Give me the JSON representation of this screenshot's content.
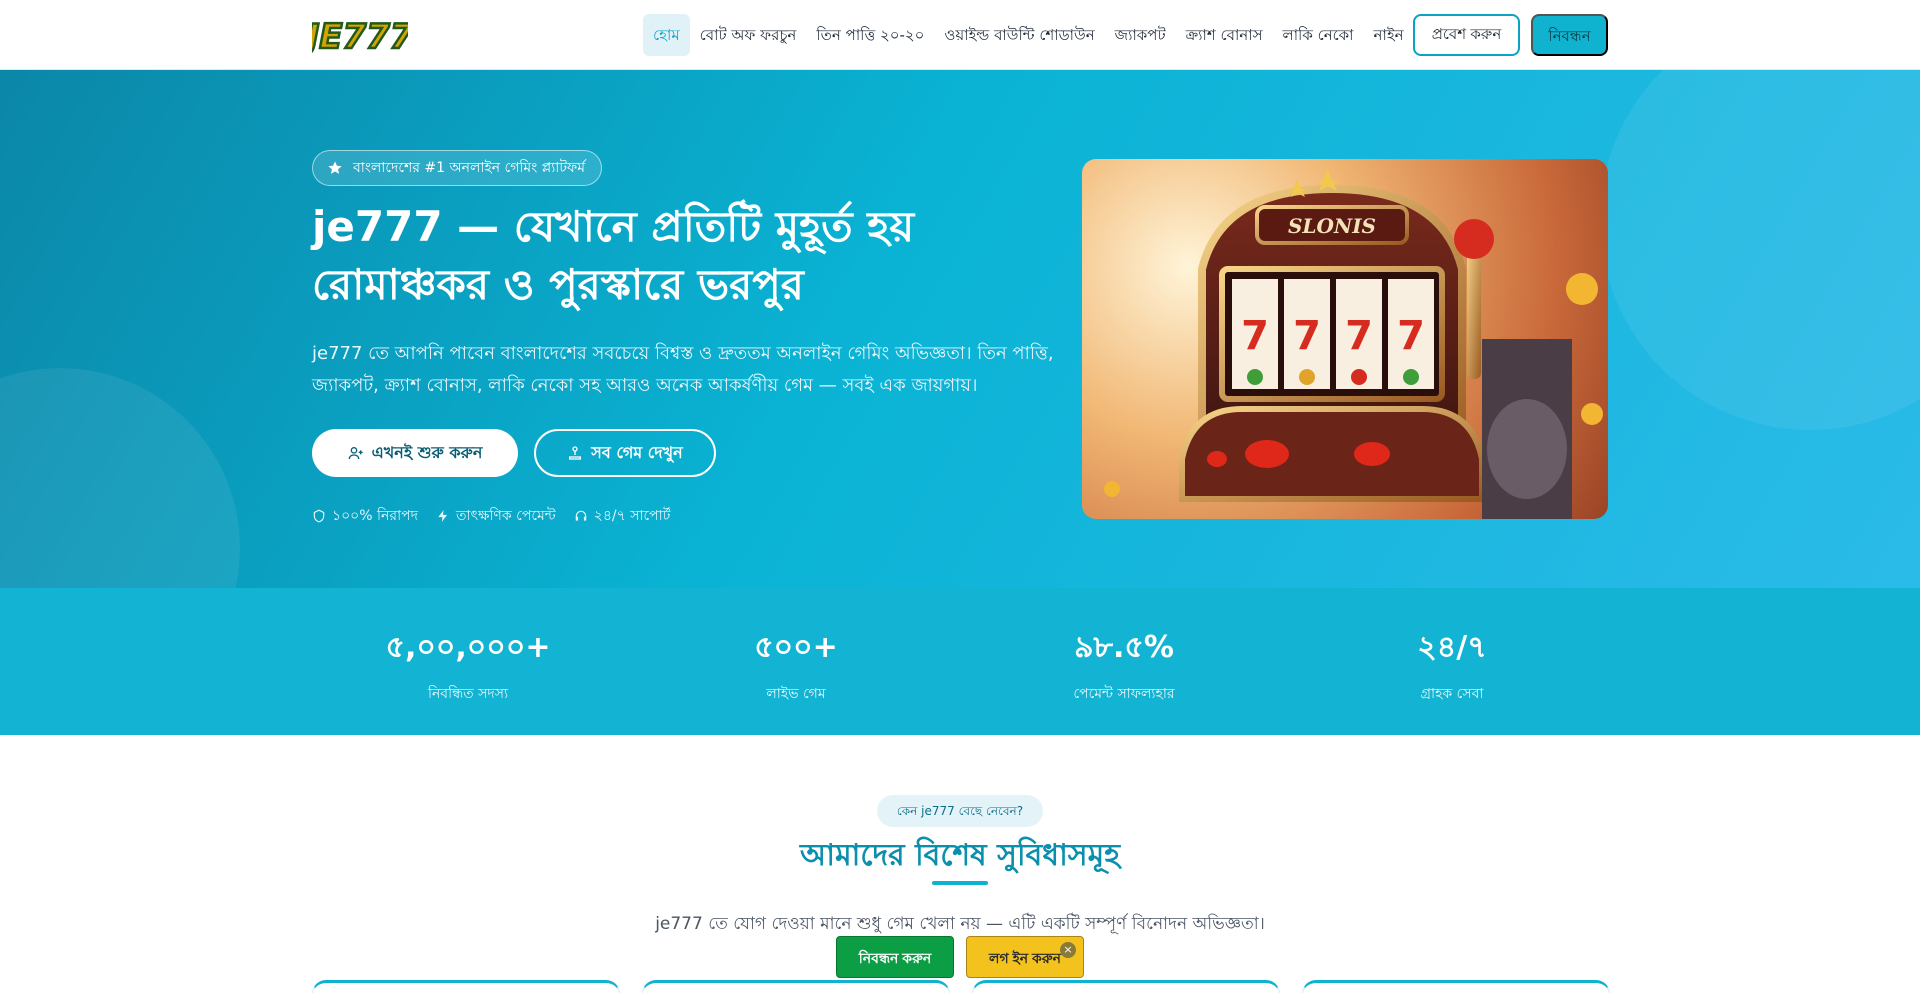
{
  "nav": {
    "logo_text": "JE777",
    "links": [
      {
        "label": "হোম",
        "active": true
      },
      {
        "label": "বোট অফ ফরচুন"
      },
      {
        "label": "তিন পাত্তি ২০-২০"
      },
      {
        "label": "ওয়াইল্ড বাউন্টি শোডাউন"
      },
      {
        "label": "জ্যাকপট"
      },
      {
        "label": "ক্র্যাশ বোনাস"
      },
      {
        "label": "লাকি নেকো"
      },
      {
        "label": "নাইন"
      }
    ],
    "login_label": "প্রবেশ করুন",
    "register_label": "নিবন্ধন"
  },
  "hero": {
    "badge": "বাংলাদেশের #1 অনলাইন গেমিং প্ল্যাটফর্ম",
    "title": "je777 — যেখানে প্রতিটি মুহূর্ত হয় রোমাঞ্চকর ও পুরস্কারে ভরপুর",
    "description": "je777 তে আপনি পাবেন বাংলাদেশের সবচেয়ে বিশ্বস্ত ও দ্রুততম অনলাইন গেমিং অভিজ্ঞতা। তিন পাত্তি, জ্যাকপট, ক্র্যাশ বোনাস, লাকি নেকো সহ আরও অনেক আকর্ষণীয় গেম — সবই এক জায়গায়।",
    "cta_primary": "এখনই শুরু করুন",
    "cta_secondary": "সব গেম দেখুন",
    "features": [
      "১০০% নিরাপদ",
      "তাৎক্ষণিক পেমেন্ট",
      "২৪/৭ সাপোর্ট"
    ],
    "image_sign": "SLONIS"
  },
  "stats": [
    {
      "value": "৫,০০,০০০+",
      "label": "নিবন্ধিত সদস্য"
    },
    {
      "value": "৫০০+",
      "label": "লাইভ গেম"
    },
    {
      "value": "৯৮.৫%",
      "label": "পেমেন্ট সাফল্যহার"
    },
    {
      "value": "২৪/৭",
      "label": "গ্রাহক সেবা"
    }
  ],
  "benefits": {
    "tag": "কেন je777 বেছে নেবেন?",
    "title": "আমাদের বিশেষ সুবিধাসমূহ",
    "description": "je777 তে যোগ দেওয়া মানে শুধু গেম খেলা নয় — এটি একটি সম্পূর্ণ বিনোদন অভিজ্ঞতা।"
  },
  "floating_bar": {
    "register_label": "নিবন্ধন করুন",
    "login_label": "লগ ইন করুন",
    "close_label": "×"
  },
  "colors": {
    "primary": "#0fb3cf",
    "hero_start": "#0b87a8",
    "hero_end": "#2bbbe9",
    "register_green": "#0b9e45",
    "login_yellow": "#f4c21d"
  }
}
